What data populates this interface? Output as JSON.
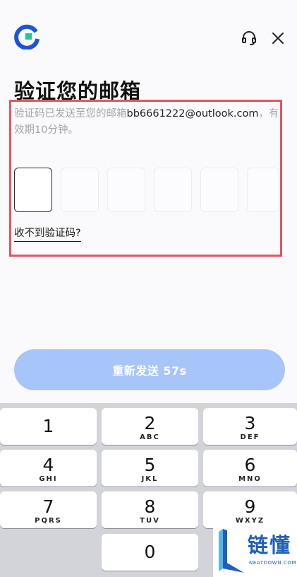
{
  "header": {
    "logo_icon": "brand-logo-icon",
    "support_icon": "headset-icon",
    "close_icon": "close-icon"
  },
  "title": "验证您的邮箱",
  "subtitle": {
    "prefix": "验证码已发送至您的邮箱",
    "email": "bb6661222@outlook.com",
    "suffix": "，有效期10分钟。"
  },
  "code_input": {
    "length": 6,
    "active_index": 0
  },
  "no_code_link": "收不到验证码?",
  "resend_button": "重新发送 57s",
  "keypad": {
    "keys": [
      {
        "num": "1",
        "letters": ""
      },
      {
        "num": "2",
        "letters": "ABC"
      },
      {
        "num": "3",
        "letters": "DEF"
      },
      {
        "num": "4",
        "letters": "GHI"
      },
      {
        "num": "5",
        "letters": "JKL"
      },
      {
        "num": "6",
        "letters": "MNO"
      },
      {
        "num": "7",
        "letters": "PQRS"
      },
      {
        "num": "8",
        "letters": "TUV"
      },
      {
        "num": "9",
        "letters": "WXYZ"
      },
      {
        "num": "0",
        "letters": ""
      }
    ]
  },
  "watermark": {
    "text": "链懂",
    "sub": "NEATDOWN.COM"
  },
  "colors": {
    "accent": "#a7c5f8",
    "highlight": "#e0565e",
    "brand": "#1f5fb8"
  }
}
